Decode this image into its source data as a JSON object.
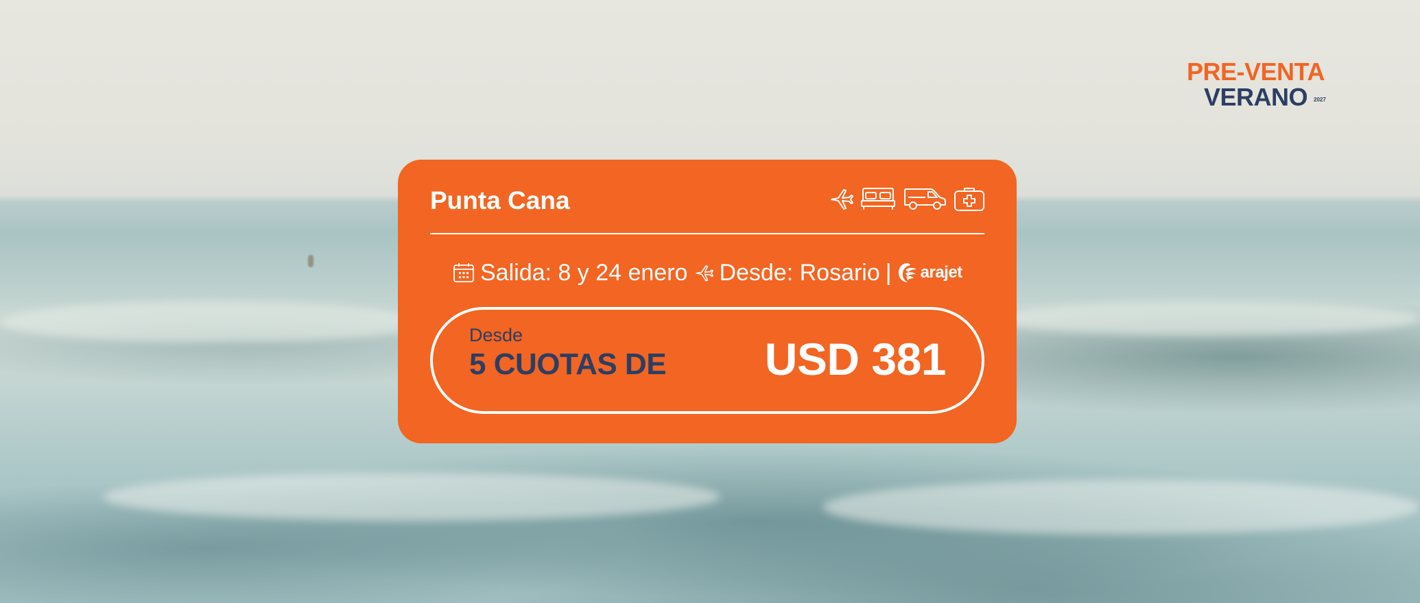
{
  "brand": {
    "line1": "PRE-VENTA",
    "line2": "VERANO",
    "year": "2027"
  },
  "card": {
    "destination": "Punta Cana",
    "services": [
      "plane-icon",
      "bed-icon",
      "van-icon",
      "first-aid-kit-icon"
    ],
    "departure_label": "Salida: 8 y 24 enero",
    "origin_label": "Desde: Rosario",
    "separator": "|",
    "airline": "arajet",
    "price": {
      "from_label": "Desde",
      "installments_label": "5 CUOTAS DE",
      "amount": "USD 381"
    }
  },
  "colors": {
    "accent": "#f26522",
    "navy": "#2c3e63",
    "white": "#ffffff"
  }
}
